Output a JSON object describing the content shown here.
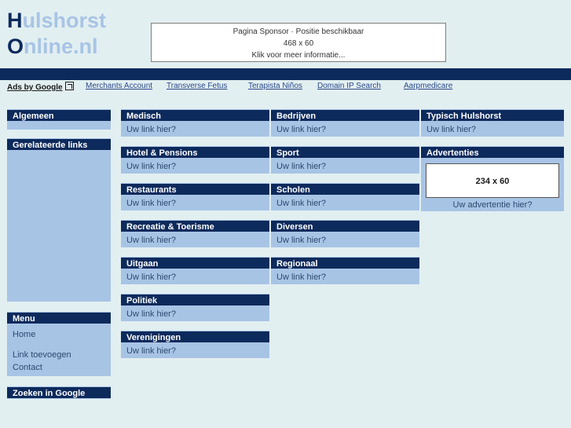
{
  "site": {
    "logo_line1_cap": "H",
    "logo_line1_rest": "ulshorst",
    "logo_line2_cap": "O",
    "logo_line2_rest": "nline.nl"
  },
  "sponsor": {
    "line1": "Pagina Sponsor · Positie beschikbaar",
    "line2": "468 x 60",
    "line3": "Klik voor meer informatie..."
  },
  "adsbar": {
    "ads_by_google": "Ads by Google",
    "links": [
      "Merchants Account",
      "Transverse Fetus",
      "Terapista Niños",
      "Domain IP Search",
      "Aarpmedicare"
    ]
  },
  "sidebar": {
    "algemeen": {
      "title": "Algemeen"
    },
    "gerelateerde": {
      "title": "Gerelateerde links"
    },
    "menu": {
      "title": "Menu",
      "items": [
        "Home",
        "Link toevoegen",
        "Contact"
      ]
    },
    "zoeken": {
      "title": "Zoeken in Google"
    }
  },
  "placeholder_link": "Uw link hier?",
  "columns": {
    "col1": [
      {
        "title": "Medisch",
        "link": "Uw link hier?"
      },
      {
        "title": "Hotel & Pensions",
        "link": "Uw link hier?"
      },
      {
        "title": "Restaurants",
        "link": "Uw link hier?"
      },
      {
        "title": "Recreatie & Toerisme",
        "link": "Uw link hier?"
      },
      {
        "title": "Uitgaan",
        "link": "Uw link hier?"
      },
      {
        "title": "Politiek",
        "link": "Uw link hier?"
      },
      {
        "title": "Verenigingen",
        "link": "Uw link hier?"
      }
    ],
    "col2": [
      {
        "title": "Bedrijven",
        "link": "Uw link hier?"
      },
      {
        "title": "Sport",
        "link": "Uw link hier?"
      },
      {
        "title": "Scholen",
        "link": "Uw link hier?"
      },
      {
        "title": "Diversen",
        "link": "Uw link hier?"
      },
      {
        "title": "Regionaal",
        "link": "Uw link hier?"
      }
    ],
    "col3": [
      {
        "title": "Typisch Hulshorst",
        "link": "Uw link hier?"
      }
    ]
  },
  "advertenties": {
    "title": "Advertenties",
    "banner_size": "234 x 60",
    "caption": "Uw advertentie hier?"
  },
  "colors": {
    "navy": "#0d2a5c",
    "light_blue": "#a8c4e5",
    "background": "#e2eff1",
    "link_blue": "#2b4a8c"
  }
}
